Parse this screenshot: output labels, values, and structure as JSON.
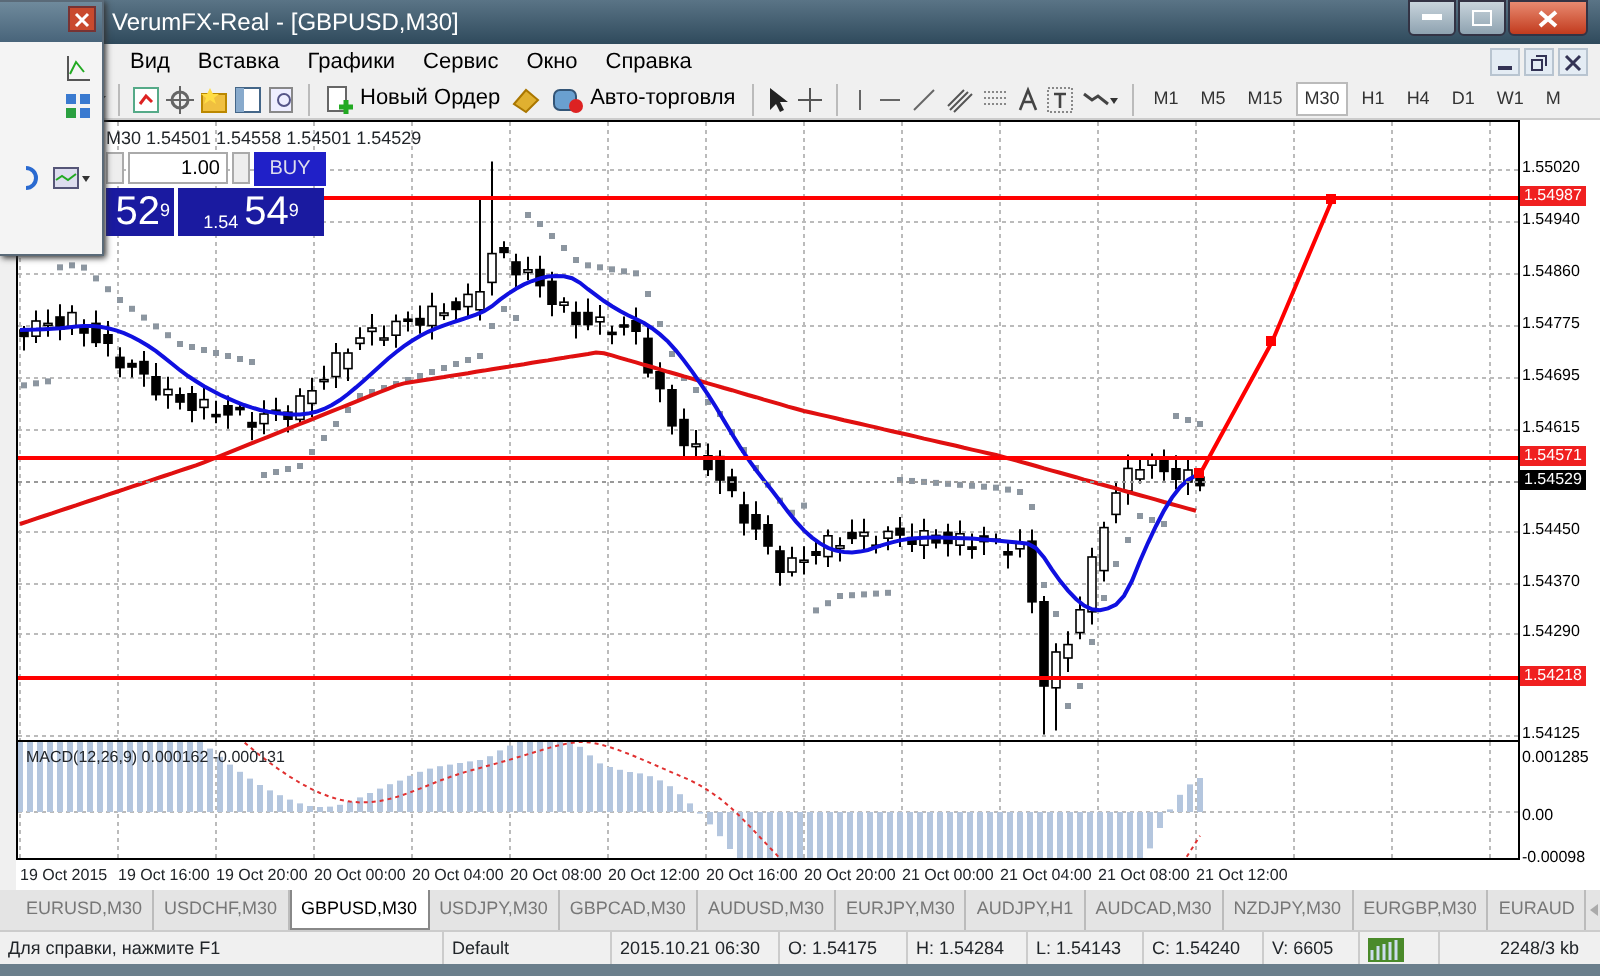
{
  "window": {
    "title": "VerumFX-Real - [GBPUSD,M30]"
  },
  "menu": [
    "Вид",
    "Вставка",
    "Графики",
    "Сервис",
    "Окно",
    "Справка"
  ],
  "toolbar": {
    "order_button": "Новый Ордер",
    "auto_trading_button": "Авто-торговля",
    "timeframes": [
      {
        "label": "M1",
        "selected": false
      },
      {
        "label": "M5",
        "selected": false
      },
      {
        "label": "M15",
        "selected": false
      },
      {
        "label": "M30",
        "selected": true
      },
      {
        "label": "H1",
        "selected": false
      },
      {
        "label": "H4",
        "selected": false
      },
      {
        "label": "D1",
        "selected": false
      },
      {
        "label": "W1",
        "selected": false
      },
      {
        "label": "M",
        "selected": false
      }
    ]
  },
  "chart": {
    "info": "M30  1.54501 1.54558 1.54501 1.54529",
    "trade_panel": {
      "lot": "1.00",
      "buy_label": "BUY",
      "sell_price": "52$^{9}$",
      "buy_small": "1.54",
      "buy_price": "54$^{9}$"
    },
    "price_ticks": [
      "1.55020",
      "1.54940",
      "1.54860",
      "1.54775",
      "1.54695",
      "1.54615",
      "1.54450",
      "1.54370",
      "1.54290",
      "1.54125"
    ],
    "price_markers": [
      {
        "label": "1.54987",
        "kind": "line"
      },
      {
        "label": "1.54571",
        "kind": "line"
      },
      {
        "label": "1.54529",
        "kind": "bid"
      },
      {
        "label": "1.54218",
        "kind": "line"
      }
    ]
  },
  "indicator": {
    "label": "MACD(12,26,9) 0.000162 -0.000131",
    "ticks": [
      "0.001285",
      "0.00",
      "-0.00098"
    ]
  },
  "time_axis": [
    "19 Oct 2015",
    "19 Oct 16:00",
    "19 Oct 20:00",
    "20 Oct 00:00",
    "20 Oct 04:00",
    "20 Oct 08:00",
    "20 Oct 12:00",
    "20 Oct 16:00",
    "20 Oct 20:00",
    "21 Oct 00:00",
    "21 Oct 04:00",
    "21 Oct 08:00",
    "21 Oct 12:00"
  ],
  "tabs": [
    {
      "label": "EURUSD,M30",
      "selected": false
    },
    {
      "label": "USDCHF,M30",
      "selected": false
    },
    {
      "label": "GBPUSD,M30",
      "selected": true
    },
    {
      "label": "USDJPY,M30",
      "selected": false
    },
    {
      "label": "GBPCAD,M30",
      "selected": false
    },
    {
      "label": "AUDUSD,M30",
      "selected": false
    },
    {
      "label": "EURJPY,M30",
      "selected": false
    },
    {
      "label": "AUDJPY,H1",
      "selected": false
    },
    {
      "label": "AUDCAD,M30",
      "selected": false
    },
    {
      "label": "NZDJPY,M30",
      "selected": false
    },
    {
      "label": "EURGBP,M30",
      "selected": false
    },
    {
      "label": "EURAUD",
      "selected": false
    }
  ],
  "status_bar": {
    "fields": [
      "Для справки, нажмите F1",
      "Default",
      "2015.10.21 06:30",
      "O: 1.54175",
      "H: 1.54284",
      "L: 1.54143",
      "C: 1.54240",
      "V: 6605"
    ],
    "traffic": "2248/3 kb"
  }
}
